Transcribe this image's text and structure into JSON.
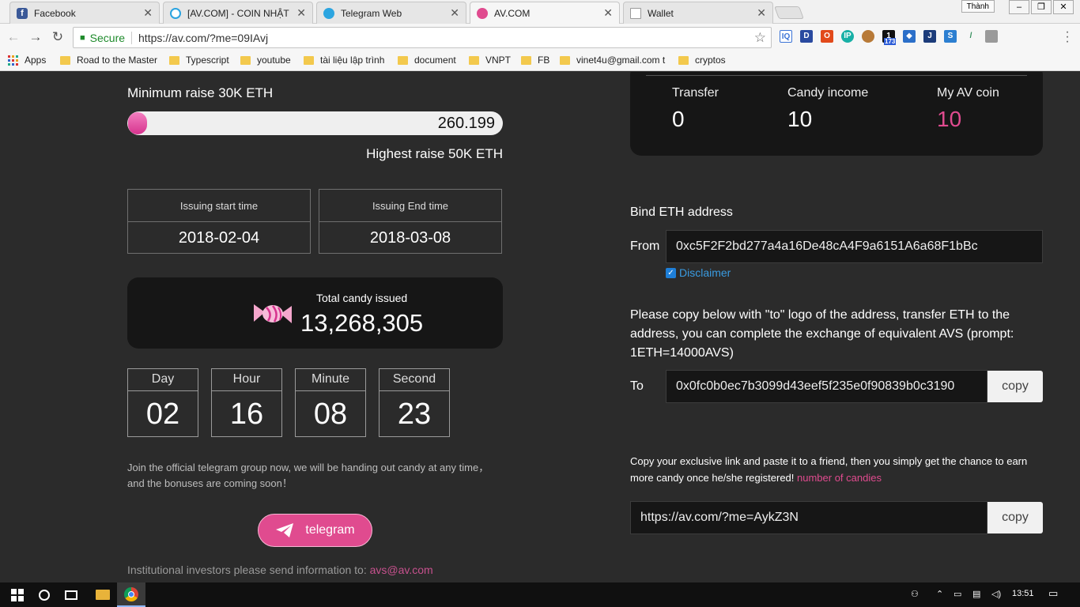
{
  "browser": {
    "tabs": [
      {
        "title": "Facebook",
        "color": "#3b5998"
      },
      {
        "title": "[AV.COM] - COIN NHẬT",
        "color": "#2aa3e0"
      },
      {
        "title": "Telegram Web",
        "color": "#2ca5e0"
      },
      {
        "title": "AV.COM",
        "color": "#e04b8f"
      },
      {
        "title": "Wallet",
        "color": "#dddddd"
      }
    ],
    "user": "Thành",
    "secure_label": "Secure",
    "url": "https://av.com/?me=09IAvj",
    "bookmarks": [
      "Apps",
      "Road to the Master",
      "Typescript",
      "youtube",
      "tài liệu lập trình",
      "document",
      "VNPT",
      "FB",
      "vinet4u@gmail.com t",
      "cryptos"
    ],
    "ext_badge": "173"
  },
  "raise": {
    "min_label": "Minimum raise 30K ETH",
    "max_label": "Highest raise 50K ETH",
    "current": "260.199",
    "progress_fraction": 0.05
  },
  "issuing": {
    "start_label": "Issuing start time",
    "start_value": "2018-02-04",
    "end_label": "Issuing End time",
    "end_value": "2018-03-08"
  },
  "candy": {
    "label": "Total candy issued",
    "value": "13,268,305"
  },
  "countdown": [
    {
      "label": "Day",
      "value": "02"
    },
    {
      "label": "Hour",
      "value": "16"
    },
    {
      "label": "Minute",
      "value": "08"
    },
    {
      "label": "Second",
      "value": "23"
    }
  ],
  "join_text": "Join the official telegram group now, we will be handing out candy at any time，and the bonuses are coming soon！",
  "telegram_label": "telegram",
  "institutional": {
    "text": "Institutional investors please send information to: ",
    "email": "avs@av.com"
  },
  "stats": [
    {
      "label": "Transfer",
      "value": "0"
    },
    {
      "label": "Candy income",
      "value": "10"
    },
    {
      "label": "My AV coin",
      "value": "10"
    }
  ],
  "bind": {
    "title": "Bind ETH address",
    "from_label": "From",
    "from_value": "0xc5F2F2bd277a4a16De48cA4F9a6151A6a68F1bBc",
    "disclaimer": "Disclaimer",
    "copy_instructions": "Please copy below with \"to\" logo of the address, transfer ETH to the address, you can complete the exchange of equivalent AVS (prompt: 1ETH=14000AVS)",
    "to_label": "To",
    "to_value": "0x0fc0b0ec7b3099d43eef5f235e0f90839b0c3190",
    "copy_label": "copy"
  },
  "share": {
    "text": "Copy your exclusive link and paste it to a friend, then you simply get the chance to earn more candy once he/she registered! ",
    "link_label": "number of candies",
    "link": "https://av.com/?me=AykZ3N",
    "copy_label": "copy"
  },
  "taskbar": {
    "time": "13:51"
  }
}
